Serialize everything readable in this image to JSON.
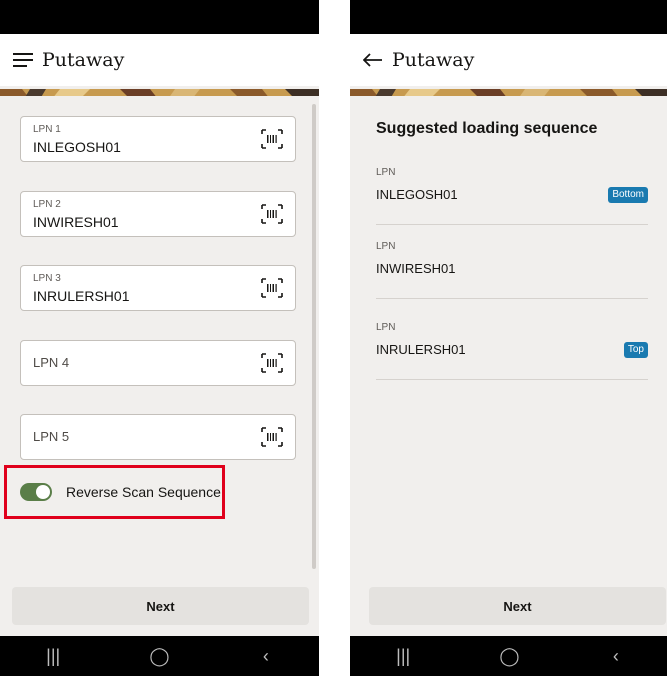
{
  "left_screen": {
    "title": "Putaway",
    "nav_icon": "hamburger-menu-icon",
    "fields": [
      {
        "label": "LPN 1",
        "value": "INLEGOSH01"
      },
      {
        "label": "LPN 2",
        "value": "INWIRESH01"
      },
      {
        "label": "LPN 3",
        "value": "INRULERSH01"
      },
      {
        "placeholder": "LPN 4"
      },
      {
        "placeholder": "LPN 5"
      }
    ],
    "toggle": {
      "label": "Reverse Scan Sequence",
      "state": "on"
    },
    "next_label": "Next"
  },
  "right_screen": {
    "title": "Putaway",
    "nav_icon": "back-arrow-icon",
    "section_title": "Suggested loading sequence",
    "items": [
      {
        "label": "LPN",
        "value": "INLEGOSH01",
        "badge": "Bottom"
      },
      {
        "label": "LPN",
        "value": "INWIRESH01"
      },
      {
        "label": "LPN",
        "value": "INRULERSH01",
        "badge": "Top"
      }
    ],
    "next_label": "Next"
  },
  "android_nav": {
    "recents": "|||",
    "home": "◯",
    "back": "‹"
  },
  "colors": {
    "toggle_on": "#5a7e48",
    "badge": "#1a7ab0",
    "highlight": "#e0001b"
  }
}
